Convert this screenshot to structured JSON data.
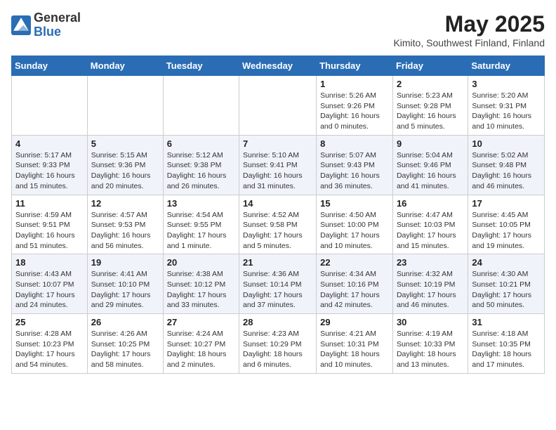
{
  "header": {
    "logo_general": "General",
    "logo_blue": "Blue",
    "month_title": "May 2025",
    "location": "Kimito, Southwest Finland, Finland"
  },
  "weekdays": [
    "Sunday",
    "Monday",
    "Tuesday",
    "Wednesday",
    "Thursday",
    "Friday",
    "Saturday"
  ],
  "weeks": [
    [
      {
        "day": "",
        "info": ""
      },
      {
        "day": "",
        "info": ""
      },
      {
        "day": "",
        "info": ""
      },
      {
        "day": "",
        "info": ""
      },
      {
        "day": "1",
        "info": "Sunrise: 5:26 AM\nSunset: 9:26 PM\nDaylight: 16 hours\nand 0 minutes."
      },
      {
        "day": "2",
        "info": "Sunrise: 5:23 AM\nSunset: 9:28 PM\nDaylight: 16 hours\nand 5 minutes."
      },
      {
        "day": "3",
        "info": "Sunrise: 5:20 AM\nSunset: 9:31 PM\nDaylight: 16 hours\nand 10 minutes."
      }
    ],
    [
      {
        "day": "4",
        "info": "Sunrise: 5:17 AM\nSunset: 9:33 PM\nDaylight: 16 hours\nand 15 minutes."
      },
      {
        "day": "5",
        "info": "Sunrise: 5:15 AM\nSunset: 9:36 PM\nDaylight: 16 hours\nand 20 minutes."
      },
      {
        "day": "6",
        "info": "Sunrise: 5:12 AM\nSunset: 9:38 PM\nDaylight: 16 hours\nand 26 minutes."
      },
      {
        "day": "7",
        "info": "Sunrise: 5:10 AM\nSunset: 9:41 PM\nDaylight: 16 hours\nand 31 minutes."
      },
      {
        "day": "8",
        "info": "Sunrise: 5:07 AM\nSunset: 9:43 PM\nDaylight: 16 hours\nand 36 minutes."
      },
      {
        "day": "9",
        "info": "Sunrise: 5:04 AM\nSunset: 9:46 PM\nDaylight: 16 hours\nand 41 minutes."
      },
      {
        "day": "10",
        "info": "Sunrise: 5:02 AM\nSunset: 9:48 PM\nDaylight: 16 hours\nand 46 minutes."
      }
    ],
    [
      {
        "day": "11",
        "info": "Sunrise: 4:59 AM\nSunset: 9:51 PM\nDaylight: 16 hours\nand 51 minutes."
      },
      {
        "day": "12",
        "info": "Sunrise: 4:57 AM\nSunset: 9:53 PM\nDaylight: 16 hours\nand 56 minutes."
      },
      {
        "day": "13",
        "info": "Sunrise: 4:54 AM\nSunset: 9:55 PM\nDaylight: 17 hours\nand 1 minute."
      },
      {
        "day": "14",
        "info": "Sunrise: 4:52 AM\nSunset: 9:58 PM\nDaylight: 17 hours\nand 5 minutes."
      },
      {
        "day": "15",
        "info": "Sunrise: 4:50 AM\nSunset: 10:00 PM\nDaylight: 17 hours\nand 10 minutes."
      },
      {
        "day": "16",
        "info": "Sunrise: 4:47 AM\nSunset: 10:03 PM\nDaylight: 17 hours\nand 15 minutes."
      },
      {
        "day": "17",
        "info": "Sunrise: 4:45 AM\nSunset: 10:05 PM\nDaylight: 17 hours\nand 19 minutes."
      }
    ],
    [
      {
        "day": "18",
        "info": "Sunrise: 4:43 AM\nSunset: 10:07 PM\nDaylight: 17 hours\nand 24 minutes."
      },
      {
        "day": "19",
        "info": "Sunrise: 4:41 AM\nSunset: 10:10 PM\nDaylight: 17 hours\nand 29 minutes."
      },
      {
        "day": "20",
        "info": "Sunrise: 4:38 AM\nSunset: 10:12 PM\nDaylight: 17 hours\nand 33 minutes."
      },
      {
        "day": "21",
        "info": "Sunrise: 4:36 AM\nSunset: 10:14 PM\nDaylight: 17 hours\nand 37 minutes."
      },
      {
        "day": "22",
        "info": "Sunrise: 4:34 AM\nSunset: 10:16 PM\nDaylight: 17 hours\nand 42 minutes."
      },
      {
        "day": "23",
        "info": "Sunrise: 4:32 AM\nSunset: 10:19 PM\nDaylight: 17 hours\nand 46 minutes."
      },
      {
        "day": "24",
        "info": "Sunrise: 4:30 AM\nSunset: 10:21 PM\nDaylight: 17 hours\nand 50 minutes."
      }
    ],
    [
      {
        "day": "25",
        "info": "Sunrise: 4:28 AM\nSunset: 10:23 PM\nDaylight: 17 hours\nand 54 minutes."
      },
      {
        "day": "26",
        "info": "Sunrise: 4:26 AM\nSunset: 10:25 PM\nDaylight: 17 hours\nand 58 minutes."
      },
      {
        "day": "27",
        "info": "Sunrise: 4:24 AM\nSunset: 10:27 PM\nDaylight: 18 hours\nand 2 minutes."
      },
      {
        "day": "28",
        "info": "Sunrise: 4:23 AM\nSunset: 10:29 PM\nDaylight: 18 hours\nand 6 minutes."
      },
      {
        "day": "29",
        "info": "Sunrise: 4:21 AM\nSunset: 10:31 PM\nDaylight: 18 hours\nand 10 minutes."
      },
      {
        "day": "30",
        "info": "Sunrise: 4:19 AM\nSunset: 10:33 PM\nDaylight: 18 hours\nand 13 minutes."
      },
      {
        "day": "31",
        "info": "Sunrise: 4:18 AM\nSunset: 10:35 PM\nDaylight: 18 hours\nand 17 minutes."
      }
    ]
  ]
}
